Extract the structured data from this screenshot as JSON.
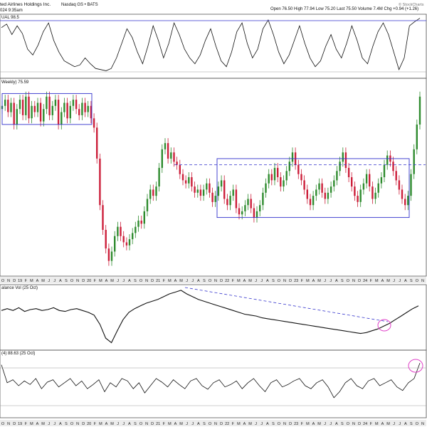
{
  "header": {
    "symbol_text": "ted Airlines Holdings Inc.",
    "exchange_text": "Nasdaq GS • BATS",
    "date_text": "024 9:35am",
    "ohlc_text": "Open 76.50  High 77.94  Low 75.20  Last 75.50  Volume 7.4M  Chg +0.94 (+1.26)",
    "watermark": "© StockCharts"
  },
  "panels": {
    "top_label": "UAL 98.5",
    "price_label": "Weekly) 75.59",
    "obv_label": "alance Vol (25 Oct)",
    "bottom_label": "(4) 88.63 (25 Oct)"
  },
  "x_axis_labels": [
    "O",
    "N",
    "D",
    "19",
    "F",
    "M",
    "A",
    "M",
    "J",
    "J",
    "A",
    "S",
    "O",
    "N",
    "D",
    "20",
    "F",
    "M",
    "A",
    "M",
    "J",
    "J",
    "A",
    "S",
    "O",
    "N",
    "D",
    "21",
    "F",
    "M",
    "A",
    "M",
    "J",
    "J",
    "A",
    "S",
    "O",
    "N",
    "D",
    "22",
    "F",
    "M",
    "A",
    "M",
    "J",
    "J",
    "A",
    "S",
    "O",
    "N",
    "D",
    "23",
    "F",
    "M",
    "A",
    "M",
    "J",
    "J",
    "A",
    "S",
    "O",
    "N",
    "D",
    "24",
    "F",
    "M",
    "A",
    "M",
    "J",
    "J",
    "A",
    "S",
    "O",
    "N"
  ],
  "colors": {
    "up": "#2e8b2e",
    "down": "#cc1f3a",
    "line": "#111111",
    "box": "#3333cc",
    "highlight": "#e040c8",
    "grid": "#9a9a9a"
  },
  "chart_data": [
    {
      "type": "line",
      "panel": "relative strength indicator (top)",
      "label": "UAL 98.5",
      "values": [
        82,
        88,
        70,
        85,
        72,
        45,
        35,
        52,
        75,
        90,
        60,
        40,
        25,
        20,
        15,
        18,
        30,
        20,
        12,
        10,
        8,
        12,
        30,
        55,
        80,
        65,
        40,
        20,
        50,
        85,
        60,
        30,
        55,
        90,
        70,
        45,
        30,
        20,
        35,
        60,
        80,
        50,
        25,
        15,
        40,
        75,
        90,
        55,
        30,
        45,
        80,
        95,
        70,
        40,
        20,
        35,
        60,
        85,
        55,
        30,
        15,
        25,
        50,
        70,
        45,
        30,
        55,
        85,
        60,
        30,
        20,
        50,
        75,
        90,
        70,
        40,
        10,
        30,
        85,
        92,
        98
      ]
    },
    {
      "type": "candlestick",
      "panel": "price (weekly)",
      "label": "Weekly) 75.59",
      "weekly_closes_approx": [
        72,
        74,
        70,
        73,
        66,
        71,
        74,
        69,
        75,
        68,
        72,
        70,
        73,
        67,
        71,
        75,
        69,
        72,
        74,
        66,
        70,
        73,
        68,
        72,
        74,
        71,
        69,
        73,
        70,
        72,
        68,
        65,
        55,
        40,
        32,
        26,
        22,
        25,
        30,
        33,
        30,
        28,
        27,
        29,
        31,
        33,
        35,
        34,
        38,
        42,
        45,
        43,
        46,
        52,
        58,
        60,
        55,
        57,
        54,
        53,
        50,
        48,
        47,
        49,
        46,
        44,
        45,
        43,
        45,
        47,
        44,
        41,
        43,
        46,
        48,
        42,
        40,
        43,
        45,
        39,
        37,
        38,
        40,
        42,
        39,
        36,
        38,
        40,
        44,
        47,
        50,
        48,
        52,
        49,
        46,
        48,
        51,
        54,
        57,
        53,
        50,
        48,
        45,
        42,
        40,
        43,
        45,
        47,
        44,
        42,
        44,
        46,
        48,
        51,
        54,
        57,
        52,
        49,
        46,
        43,
        41,
        45,
        47,
        50,
        46,
        42,
        44,
        47,
        49,
        53,
        56,
        54,
        51,
        48,
        45,
        42,
        40,
        43,
        50,
        58,
        66,
        75
      ],
      "resistance_line": 53,
      "consolidation_boxes": [
        {
          "range": [
            66,
            76
          ]
        },
        {
          "range": [
            36,
            55
          ]
        }
      ]
    },
    {
      "type": "line",
      "panel": "on-balance volume",
      "label": "alance Vol (25 Oct)",
      "values": [
        50,
        52,
        50,
        53,
        49,
        51,
        52,
        50,
        51,
        53,
        50,
        49,
        51,
        52,
        50,
        48,
        45,
        35,
        20,
        15,
        28,
        40,
        48,
        52,
        55,
        58,
        60,
        62,
        65,
        68,
        70,
        72,
        68,
        65,
        62,
        60,
        58,
        56,
        54,
        52,
        50,
        48,
        46,
        45,
        44,
        42,
        41,
        40,
        39,
        38,
        37,
        36,
        35,
        34,
        33,
        32,
        31,
        30,
        29,
        28,
        27,
        26,
        25,
        26,
        28,
        30,
        33,
        36,
        40,
        44,
        48,
        52,
        55
      ]
    },
    {
      "type": "line",
      "panel": "oscillator (bottom)",
      "label": "(4) 88.63 (25 Oct)",
      "values": [
        85,
        55,
        60,
        50,
        58,
        52,
        62,
        45,
        56,
        60,
        48,
        55,
        62,
        50,
        58,
        45,
        52,
        60,
        40,
        55,
        48,
        62,
        58,
        45,
        55,
        38,
        50,
        62,
        56,
        48,
        60,
        52,
        45,
        58,
        62,
        50,
        44,
        55,
        60,
        48,
        52,
        58,
        45,
        55,
        62,
        50,
        40,
        55,
        60,
        48,
        52,
        58,
        62,
        50,
        45,
        55,
        60,
        48,
        30,
        40,
        55,
        62,
        50,
        45,
        58,
        62,
        50,
        55,
        60,
        48,
        42,
        55,
        62,
        88
      ]
    }
  ]
}
